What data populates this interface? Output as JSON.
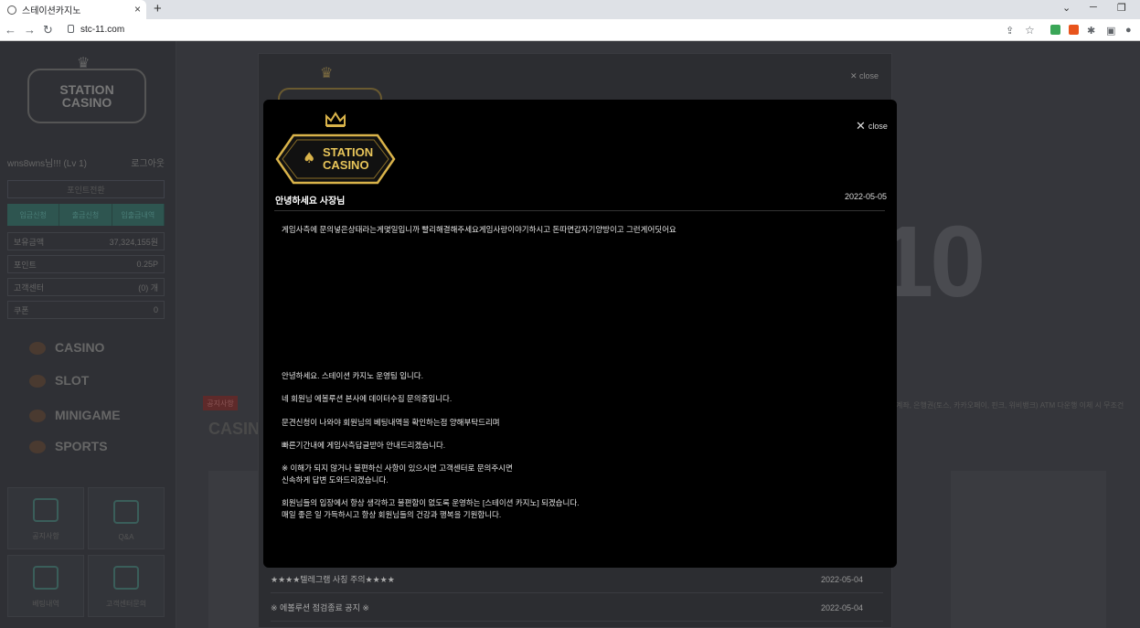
{
  "browser": {
    "tab_title": "스테이션카지노",
    "tab_close": "×",
    "new_tab": "+",
    "url": "stc-11.com"
  },
  "sidebar": {
    "logo_line1": "STATION",
    "logo_line2": "CASINO",
    "username": "wns8wns님!!! (Lv 1)",
    "logout": "로그아웃",
    "btn_withdraw_info": "포인트전환",
    "actions": [
      "입금신청",
      "출금신청",
      "입출금내역"
    ],
    "info": [
      {
        "label": "보유금액",
        "value": "37,324,155원"
      },
      {
        "label": "포인트",
        "value": "0.25P"
      },
      {
        "label": "고객센터",
        "value": "(0) 개"
      },
      {
        "label": "쿠폰",
        "value": "0"
      }
    ],
    "menu": [
      "CASINO",
      "SLOT",
      "MINIGAME",
      "SPORTS"
    ],
    "tiles": [
      "공지사항",
      "Q&A",
      "베팅내역",
      "고객센터문의"
    ]
  },
  "background": {
    "big_text": "10",
    "notice_tag": "공지사항",
    "casino_label": "CASINO",
    "banner_strip": "계좌, 은행권(토스, 카카오페이, 핀크, 위비뱅크) ATM 다운행 이체 시 무조건"
  },
  "outer_modal": {
    "close_label": "close",
    "rows": [
      {
        "title": "★★★★텔레그램 사칭 주의★★★★",
        "date": "2022-05-04"
      },
      {
        "title": "※ 에볼루션 점검종료 공지 ※",
        "date": "2022-05-04"
      }
    ]
  },
  "modal": {
    "close_label": "close",
    "logo_line1": "STATION",
    "logo_line2": "CASINO",
    "title": "안녕하세요 사장님",
    "date": "2022-05-05",
    "question": "게임사측에 문의넣은상태라는게몇일입니까 빨리해결해주세요게임사랑이야기하시고 돈따면갑자기양방이고 그런게어딧어요",
    "answer": [
      "안녕하세요. 스테이션 카지노 운영팀 입니다.",
      "네 회원님 에볼루션 본사에 데이터수집 문의중입니다.",
      "문견신청이 나와야 회원님의 베팅내역을 확인하는점 양해부탁드리며",
      "빠른기간내에 게임사측답글받아 안내드리겠습니다.",
      "※ 이해가 되지 않거나 불편하신 사항이 있으시면 고객센터로 문의주시면",
      "신속하게 답변 도와드리겠습니다.",
      "회원님들의 입장에서 항상 생각하고 불편함이 없도록 운영하는 [스테이션 카지노] 되겠습니다.",
      "매일 좋은 일 가득하시고 항상 회원님들의 건강과 행복을 기원합니다."
    ]
  },
  "colors": {
    "accent_gold": "#d9b34a",
    "modal_bg": "#000000",
    "page_bg": "#35363b"
  }
}
